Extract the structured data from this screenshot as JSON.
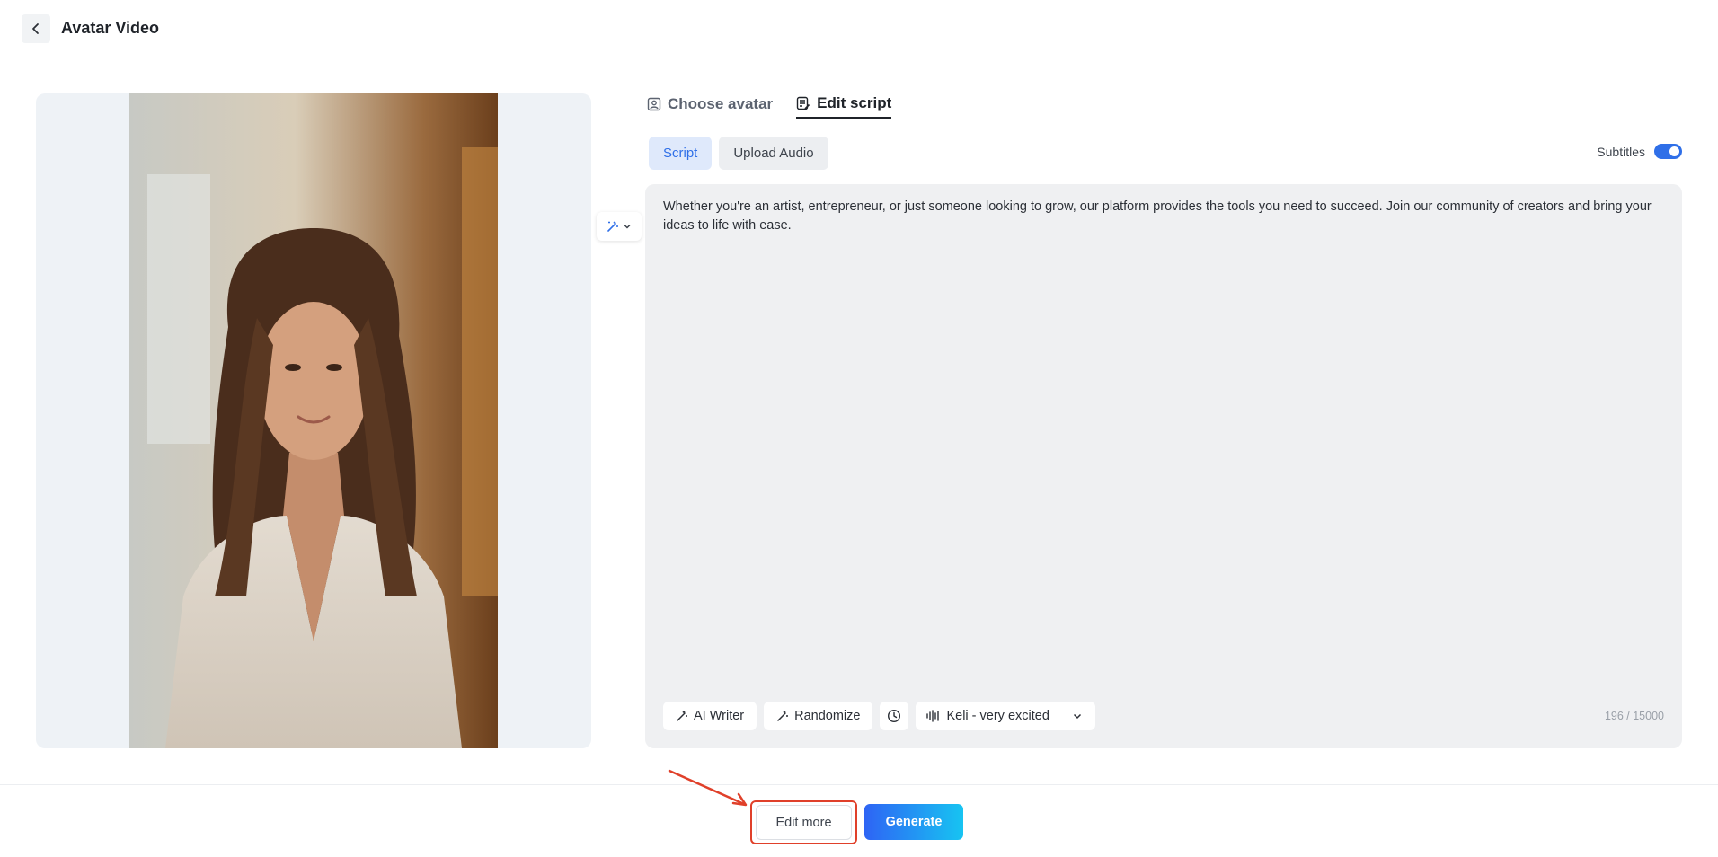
{
  "header": {
    "title": "Avatar Video",
    "back_icon": "chevron-left-icon"
  },
  "tabs": [
    {
      "label": "Choose avatar",
      "icon": "avatar-frame-icon",
      "active": false
    },
    {
      "label": "Edit script",
      "icon": "script-edit-icon",
      "active": true
    }
  ],
  "mode_tabs": [
    {
      "label": "Script",
      "active": true
    },
    {
      "label": "Upload Audio",
      "active": false
    }
  ],
  "subtitles": {
    "label": "Subtitles",
    "enabled": true
  },
  "script": {
    "text": "Whether you're an artist, entrepreneur, or just someone looking to grow, our platform provides the tools you need to succeed. Join our community of creators and bring your ideas to life with ease.",
    "char_count": "196 / 15000"
  },
  "toolbar": {
    "ai_writer": "AI Writer",
    "randomize": "Randomize",
    "voice": "Keli - very excited"
  },
  "footer": {
    "edit_more": "Edit more",
    "generate": "Generate"
  },
  "colors": {
    "accent": "#2f6fe8",
    "highlight": "#e0402a"
  }
}
